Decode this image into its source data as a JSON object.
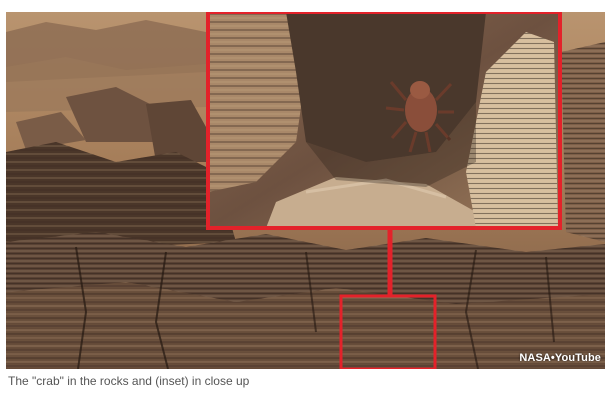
{
  "image": {
    "subject": "rock-formations-photo",
    "inset_frame_color": "#e3222a",
    "sky_tone": "#b8906c",
    "rock_dark": "#3d2c22",
    "rock_light": "#c9a581"
  },
  "credit": {
    "text": "NASA•YouTube"
  },
  "caption": {
    "text": "The \"crab\" in the rocks and (inset) in close up"
  }
}
